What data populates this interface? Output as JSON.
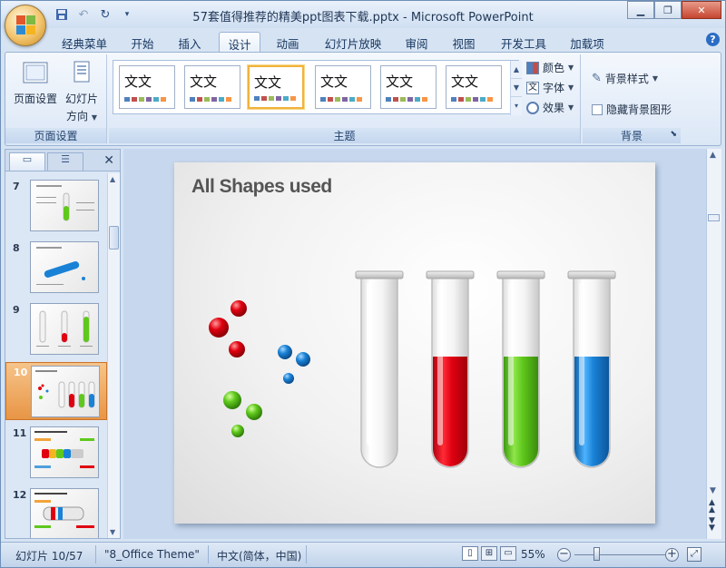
{
  "window": {
    "title": "57套值得推荐的精美ppt图表下载.pptx - Microsoft PowerPoint",
    "minimize_icon": "minimize-icon",
    "maximize_icon": "maximize-icon",
    "close_icon": "close-icon"
  },
  "quick_access": {
    "save_icon": "save-icon",
    "undo_icon": "undo-icon",
    "redo_icon": "redo-icon",
    "customize_icon": "dropdown-icon"
  },
  "ribbon": {
    "tabs": [
      {
        "label": "经典菜单",
        "active": false
      },
      {
        "label": "开始",
        "active": false
      },
      {
        "label": "插入",
        "active": false
      },
      {
        "label": "设计",
        "active": true
      },
      {
        "label": "动画",
        "active": false
      },
      {
        "label": "幻灯片放映",
        "active": false
      },
      {
        "label": "审阅",
        "active": false
      },
      {
        "label": "视图",
        "active": false
      },
      {
        "label": "开发工具",
        "active": false
      },
      {
        "label": "加载项",
        "active": false
      }
    ],
    "page_setup": {
      "group_label": "页面设置",
      "page_setup_label": "页面设置",
      "orientation_label": "幻灯片",
      "orientation_label2": "方向"
    },
    "themes": {
      "group_label": "主题",
      "thumbnails": [
        {
          "text": "文文",
          "selected": false
        },
        {
          "text": "文文",
          "selected": false
        },
        {
          "text": "文文",
          "selected": true
        },
        {
          "text": "文文",
          "selected": false
        },
        {
          "text": "文文",
          "selected": false
        },
        {
          "text": "文文",
          "selected": false
        }
      ],
      "colors_label": "颜色",
      "fonts_label": "字体",
      "effects_label": "效果"
    },
    "background": {
      "group_label": "背景",
      "styles_label": "背景样式",
      "hide_graphics_label": "隐藏背景图形",
      "hide_graphics_checked": false
    }
  },
  "slide_panel": {
    "slides": [
      {
        "number": "7",
        "active": false
      },
      {
        "number": "8",
        "active": false
      },
      {
        "number": "9",
        "active": false
      },
      {
        "number": "10",
        "active": true
      },
      {
        "number": "11",
        "active": false
      },
      {
        "number": "12",
        "active": false
      }
    ]
  },
  "slide": {
    "title": "All Shapes used"
  },
  "status_bar": {
    "slide_info": "幻灯片 10/57",
    "theme": "\"8_Office Theme\"",
    "language": "中文(简体，中国)",
    "zoom": "55%"
  },
  "colors": {
    "red": "#e00010",
    "green": "#5fc81c",
    "blue": "#1a82d6",
    "accent_orange": "#f0b33b"
  }
}
